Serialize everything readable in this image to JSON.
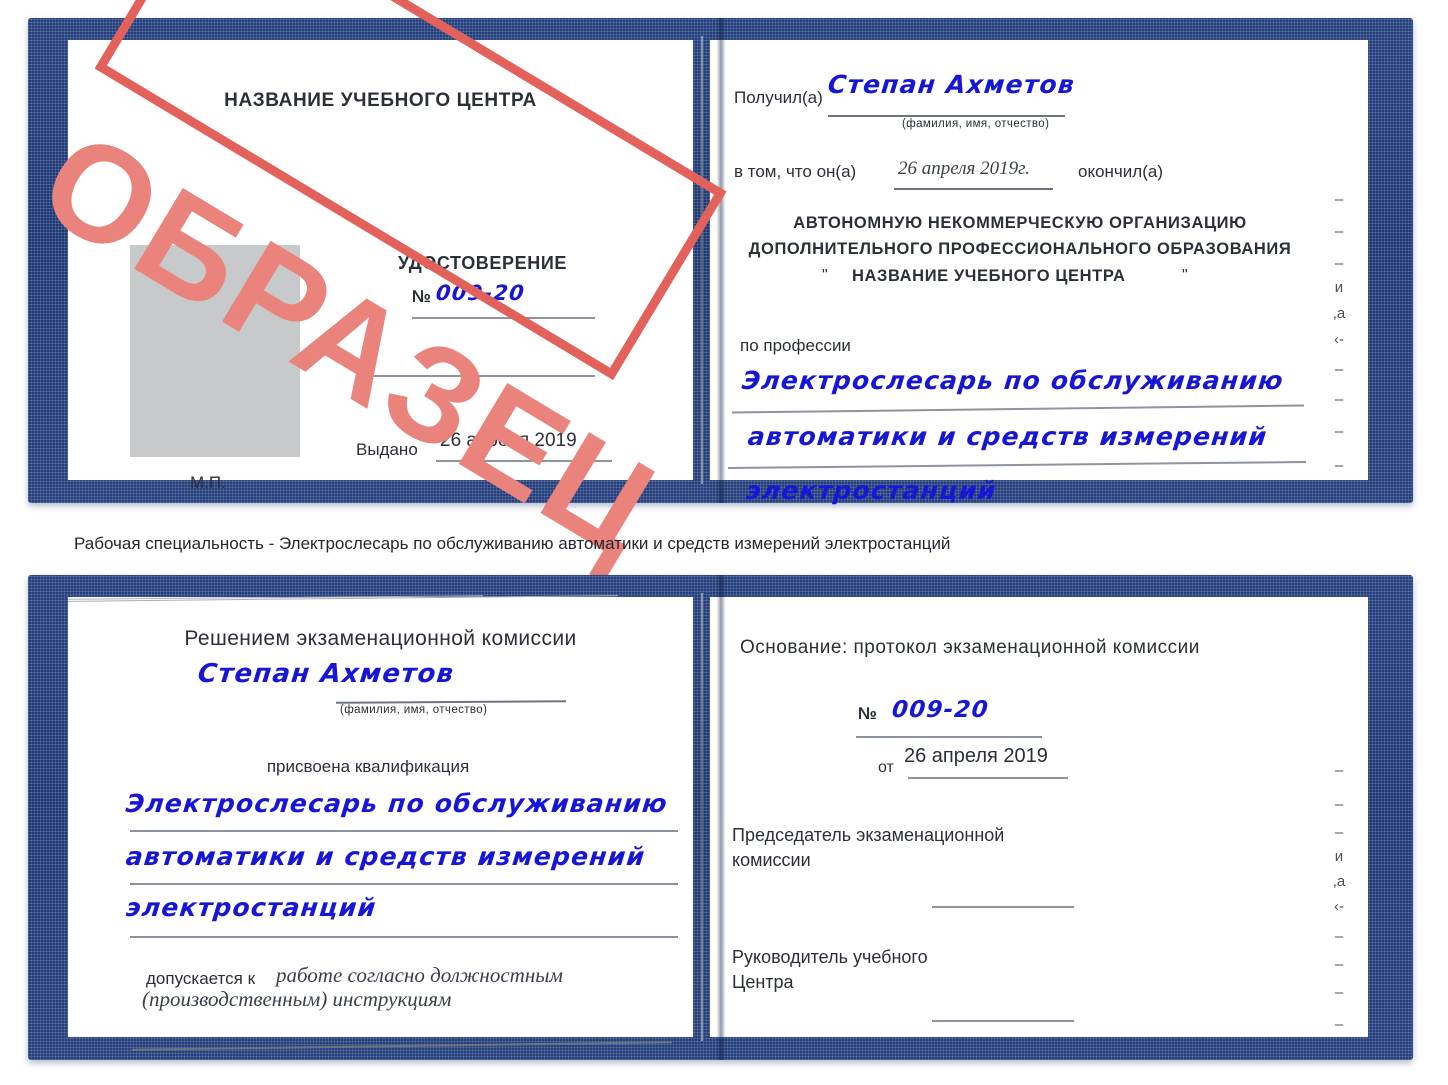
{
  "caption": "Рабочая специальность - Электрослесарь по обслуживанию автоматики и средств измерений электростанций",
  "stamp": {
    "label": "ОБРАЗЕЦ",
    "border_color": "#e2615a",
    "text_color": "#e9837c"
  },
  "colors": {
    "cover_blue": "#24407e",
    "ink_blue": "#1816d6",
    "rule_gray": "#8e949e",
    "photo_gray": "#c8c9cb"
  },
  "certificate_top": {
    "left_page": {
      "center_title": "НАЗВАНИЕ УЧЕБНОГО ЦЕНТРА",
      "doc_type": "УДОСТОВЕРЕНИЕ",
      "number_label": "№",
      "number_value": "009-20",
      "issued_label": "Выдано",
      "issued_date": "26 апреля 2019",
      "seal_label": "М.П.",
      "photo_placeholder": "photo-placeholder"
    },
    "right_page": {
      "received_label": "Получил(а)",
      "received_name": "Степан Ахметов",
      "name_hint": "(фамилия, имя, отчество)",
      "in_that_label": "в том, что он(а)",
      "completion_date": "26 апреля 2019г.",
      "finished_label": "окончил(а)",
      "org_line1": "АВТОНОМНУЮ НЕКОММЕРЧЕСКУЮ ОРГАНИЗАЦИЮ",
      "org_line2": "ДОПОЛНИТЕЛЬНОГО ПРОФЕССИОНАЛЬНОГО ОБРАЗОВАНИЯ",
      "org_quote_open": "\"",
      "org_name": "НАЗВАНИЕ УЧЕБНОГО ЦЕНТРА",
      "org_quote_close": "\"",
      "profession_label": "по профессии",
      "profession_line1": "Электрослесарь по обслуживанию",
      "profession_line2": "автоматики и средств измерений",
      "profession_line3": "электростанций",
      "edge_fragments": [
        "–",
        "–",
        "–",
        "и",
        ",а",
        "‹-",
        "–",
        "–",
        "–",
        "–"
      ]
    }
  },
  "certificate_bottom": {
    "left_page": {
      "heading": "Решением экзаменационной комиссии",
      "name": "Степан Ахметов",
      "name_hint": "(фамилия, имя, отчество)",
      "qualification_label": "присвоена квалификация",
      "qualification_line1": "Электрослесарь по обслуживанию",
      "qualification_line2": "автоматики и средств измерений",
      "qualification_line3": "электростанций",
      "admitted_label": "допускается к",
      "admitted_line1": "работе согласно должностным",
      "admitted_line2": "(производственным) инструкциям"
    },
    "right_page": {
      "basis_label": "Основание: протокол экзаменационной комиссии",
      "number_label": "№",
      "number_value": "009-20",
      "from_label": "от",
      "from_date": "26 апреля 2019",
      "chairman_line1": "Председатель экзаменационной",
      "chairman_line2": "комиссии",
      "head_line1": "Руководитель учебного",
      "head_line2": "Центра",
      "edge_fragments": [
        "–",
        "–",
        "–",
        "и",
        ",а",
        "‹-",
        "–",
        "–",
        "–",
        "–"
      ]
    }
  }
}
